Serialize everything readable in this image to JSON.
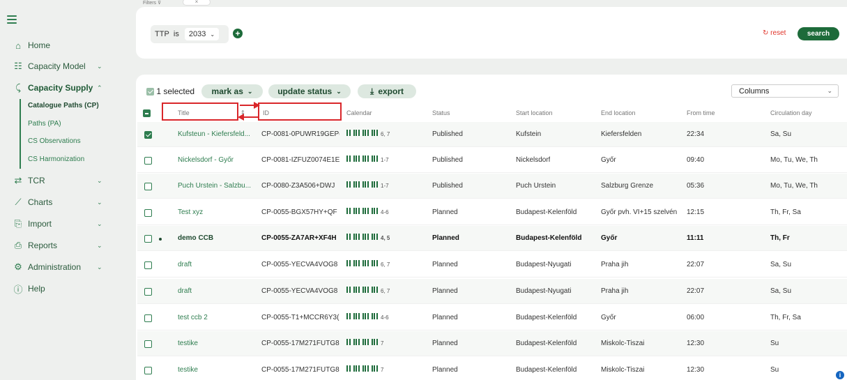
{
  "sidebar": {
    "items": [
      {
        "label": "Home",
        "icon": "home-icon"
      },
      {
        "label": "Capacity Model",
        "icon": "capacity-model-icon"
      },
      {
        "label": "Capacity Supply",
        "icon": "capacity-supply-icon"
      },
      {
        "label": "TCR",
        "icon": "tcr-icon"
      },
      {
        "label": "Charts",
        "icon": "chart-icon"
      },
      {
        "label": "Import",
        "icon": "import-icon"
      },
      {
        "label": "Reports",
        "icon": "reports-icon"
      },
      {
        "label": "Administration",
        "icon": "gear-icon"
      },
      {
        "label": "Help",
        "icon": "help-icon"
      }
    ],
    "sub_items": [
      "Catalogue Paths (CP)",
      "Paths (PA)",
      "CS Observations",
      "CS Harmonization"
    ]
  },
  "filters": {
    "tab_label": "Filters",
    "field": "TTP",
    "operator": "is",
    "value": "2033",
    "reset_label": "reset",
    "search_label": "search"
  },
  "toolbar": {
    "selected_label": "1 selected",
    "mark_as_label": "mark as",
    "update_status_label": "update status",
    "export_label": "export",
    "columns_label": "Columns"
  },
  "columns": [
    "Title",
    "ID",
    "Calendar",
    "Status",
    "Start location",
    "End location",
    "From time",
    "Circulation day"
  ],
  "rows": [
    {
      "title": "Kufsteun - Kiefersfeld...",
      "id": "CP-0081-0PUWR19GEP(",
      "cal": "6, 7",
      "status": "Published",
      "start": "Kufstein",
      "end": "Kiefersfelden",
      "time": "22:34",
      "days": "Sa, Su"
    },
    {
      "title": "Nickelsdorf - Győr",
      "id": "CP-0081-IZFUZ0074E1E",
      "cal": "1-7",
      "status": "Published",
      "start": "Nickelsdorf",
      "end": "Győr",
      "time": "09:40",
      "days": "Mo, Tu, We, Th"
    },
    {
      "title": "Puch Urstein - Salzbu...",
      "id": "CP-0080-Z3A506+DWJ",
      "cal": "1-7",
      "status": "Published",
      "start": "Puch Urstein",
      "end": "Salzburg Grenze",
      "time": "05:36",
      "days": "Mo, Tu, We, Th"
    },
    {
      "title": "Test xyz",
      "id": "CP-0055-BGX57HY+QF",
      "cal": "4-6",
      "status": "Planned",
      "start": "Budapest-Kelenföld",
      "end": "Győr pvh. VI+15 szelvén",
      "time": "12:15",
      "days": "Th, Fr, Sa"
    },
    {
      "title": "demo CCB",
      "id": "CP-0055-ZA7AR+XF4H",
      "cal": "4, 5",
      "status": "Planned",
      "start": "Budapest-Kelenföld",
      "end": "Győr",
      "time": "11:11",
      "days": "Th, Fr"
    },
    {
      "title": "draft",
      "id": "CP-0055-YECVA4VOG8",
      "cal": "6, 7",
      "status": "Planned",
      "start": "Budapest-Nyugati",
      "end": "Praha jih",
      "time": "22:07",
      "days": "Sa, Su"
    },
    {
      "title": "draft",
      "id": "CP-0055-YECVA4VOG8",
      "cal": "6, 7",
      "status": "Planned",
      "start": "Budapest-Nyugati",
      "end": "Praha jih",
      "time": "22:07",
      "days": "Sa, Su"
    },
    {
      "title": "test ccb 2",
      "id": "CP-0055-T1+MCCR6Y3(",
      "cal": "4-6",
      "status": "Planned",
      "start": "Budapest-Kelenföld",
      "end": "Győr",
      "time": "06:00",
      "days": "Th, Fr, Sa"
    },
    {
      "title": "testike",
      "id": "CP-0055-17M271FUTG8",
      "cal": "7",
      "status": "Planned",
      "start": "Budapest-Kelenföld",
      "end": "Miskolc-Tiszai",
      "time": "12:30",
      "days": "Su"
    },
    {
      "title": "testike",
      "id": "CP-0055-17M271FUTG8",
      "cal": "7",
      "status": "Planned",
      "start": "Budapest-Kelenföld",
      "end": "Miskolc-Tiszai",
      "time": "12:30",
      "days": "Su"
    }
  ],
  "colors": {
    "accent": "#2e7d4f",
    "primary": "#1d6b3a",
    "highlight": "#d9262a",
    "reset": "#e0342a"
  }
}
